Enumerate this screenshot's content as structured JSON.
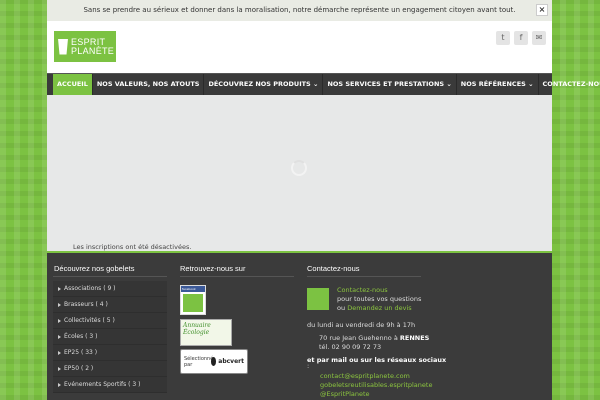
{
  "notice": {
    "text": "Sans se prendre au sérieux et donner dans la moralisation, notre démarche représente un engagement citoyen avant tout.",
    "close": "×"
  },
  "logo": {
    "line1": "ESPRIT",
    "line2": "PLANÈTE"
  },
  "social": {
    "twitter": "t",
    "facebook": "f",
    "email": "✉"
  },
  "nav": [
    {
      "label": "Accueil",
      "active": true
    },
    {
      "label": "Nos valeurs, nos atouts"
    },
    {
      "label": "Découvrez nos produits ⌄"
    },
    {
      "label": "Nos services et prestations ⌄"
    },
    {
      "label": "Nos références ⌄"
    },
    {
      "label": "Contactez-nous ⌄"
    }
  ],
  "content": {
    "message": "Les inscriptions ont été désactivées."
  },
  "footer": {
    "col1": {
      "title": "Découvrez nos gobelets",
      "items": [
        "Associations ( 9 )",
        "Brasseurs ( 4 )",
        "Collectivités ( 5 )",
        "Écoles ( 3 )",
        "EP25 ( 33 )",
        "EP50 ( 2 )",
        "Evénements Sportifs ( 3 )"
      ]
    },
    "col2": {
      "title": "Retrouvez-nous sur",
      "facebook_label": "facebook",
      "annuaire_line1": "Annuaire",
      "annuaire_line2": "Écologie",
      "abcvert_text": "Sélectionné par",
      "abcvert_brand": "abcvert"
    },
    "col3": {
      "title": "Contactez-nous",
      "link1": "Contactez-nous",
      "line2": "pour toutes vos questions",
      "line3_prefix": "ou",
      "line3_link": "Demandez un devis",
      "hours": "du lundi au vendredi de 9h à 17h",
      "address_prefix": "70 rue Jean Guehenno à",
      "address_city": "RENNES",
      "tel": "tél. 02 90 09 72 73",
      "social_title": "et par mail ou sur les réseaux sociaux",
      "social_dot": ":",
      "email": "contact@espritplanete.com",
      "fb": "gobeletsreutilisables.espritplanete",
      "twitter": "@EspritPlanete"
    }
  }
}
